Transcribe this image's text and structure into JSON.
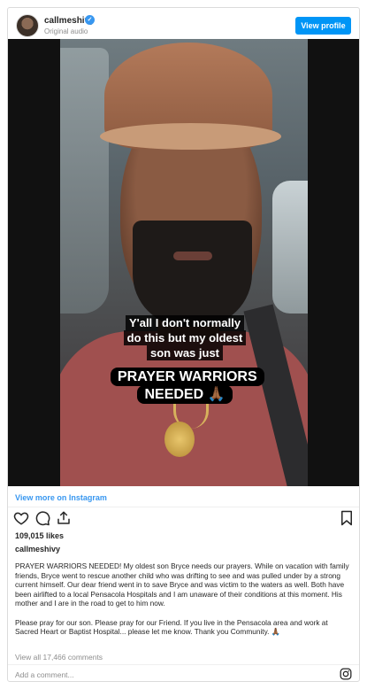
{
  "header": {
    "username": "callmeshivy",
    "verified_mark": "✓",
    "subtitle": "Original audio",
    "view_profile_label": "View profile"
  },
  "media": {
    "caption_line1": "Y'all I don't normally do this but my oldest son was just",
    "caption_line2": "PRAYER WARRIORS NEEDED 🙏🏾"
  },
  "view_more_label": "View more on Instagram",
  "actions": {
    "icons": [
      "heart-icon",
      "comment-icon",
      "share-icon",
      "bookmark-icon"
    ]
  },
  "likes": "109,015 likes",
  "caption": {
    "username": "callmeshivy",
    "paragraph1": "PRAYER WARRIORS NEEDED! My oldest son Bryce needs our prayers. While on vacation with family friends, Bryce went to rescue another child who was drifting to see and was pulled under by a strong current himself. Our dear friend went in to save Bryce and was victim to the waters as well. Both have been airlifted to a local Pensacola Hospitals and I am unaware of their conditions at this moment. His mother and I are in the road to get to him now.",
    "paragraph2": "Please pray for our son. Please pray for our Friend. If you live in the Pensacola area and work at Sacred Heart or Baptist Hospital... please let me know. Thank you Community. 🙏🏾"
  },
  "view_comments_label": "View all 17,466 comments",
  "comment": {
    "placeholder": "Add a comment..."
  },
  "colors": {
    "accent": "#0095f6",
    "link": "#3897f0",
    "muted": "#8e8e8e"
  }
}
